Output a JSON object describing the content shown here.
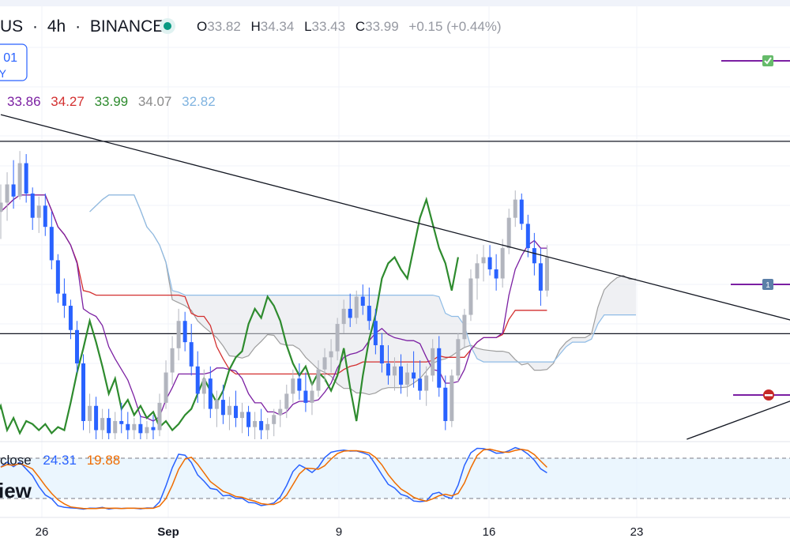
{
  "header": {
    "symbol_tail": "US",
    "sep1": "·",
    "interval": "4h",
    "sep2": "·",
    "exchange": "BINANCE",
    "ohlc": {
      "o_label": "O",
      "o_value": "33.82",
      "h_label": "H",
      "h_value": "34.34",
      "l_label": "L",
      "l_value": "33.43",
      "c_label": "C",
      "c_value": "33.99",
      "change": "+0.15 (+0.44%)"
    }
  },
  "price_badge": {
    "line1": "01",
    "line2": "Y"
  },
  "indicator_values": {
    "v1": "33.86",
    "v2": "34.27",
    "v3": "33.99",
    "v4": "34.07",
    "v5": "32.82"
  },
  "oscillator": {
    "label": "close",
    "k_value": "24.31",
    "d_value": "19.88"
  },
  "watermark": "iew",
  "time_axis": {
    "labels": [
      "26",
      "Sep",
      "9",
      "16",
      "23"
    ]
  },
  "markers": {
    "flag1": "1"
  },
  "colors": {
    "up": "#b2b5be",
    "down": "#2962ff",
    "tenkan": "#7b1fa2",
    "kijun": "#d32f2f",
    "chikou": "#2e8b2e",
    "spanA": "#9e9e9e",
    "spanB": "#8fbce6",
    "stoch_k": "#2962ff",
    "stoch_d": "#ef6c00"
  },
  "chart_data": {
    "type": "candlestick",
    "title": "",
    "interval": "4h",
    "exchange": "BINANCE",
    "last_bar": {
      "open": 33.82,
      "high": 34.34,
      "low": 33.43,
      "close": 33.99,
      "change": 0.15,
      "change_pct": 0.44
    },
    "x_axis_labels": [
      "26",
      "Sep",
      "9",
      "16",
      "23"
    ],
    "price_scale": {
      "y_min": 28.0,
      "y_max": 38.0
    },
    "candles": [
      [
        35.5,
        36.4,
        34.6,
        35.8
      ],
      [
        35.8,
        36.8,
        35.2,
        36.4
      ],
      [
        36.4,
        37.2,
        35.6,
        36.0
      ],
      [
        36.0,
        37.5,
        35.9,
        37.1
      ],
      [
        37.1,
        37.4,
        35.8,
        36.1
      ],
      [
        36.1,
        36.3,
        34.9,
        35.3
      ],
      [
        35.3,
        36.0,
        34.8,
        35.7
      ],
      [
        35.7,
        36.1,
        34.7,
        35.0
      ],
      [
        35.0,
        35.5,
        33.6,
        33.9
      ],
      [
        33.9,
        34.1,
        32.5,
        32.8
      ],
      [
        32.8,
        33.3,
        32.0,
        32.4
      ],
      [
        32.4,
        32.6,
        31.3,
        31.6
      ],
      [
        31.6,
        31.9,
        30.2,
        30.5
      ],
      [
        30.5,
        30.8,
        28.3,
        28.6
      ],
      [
        28.6,
        29.5,
        28.2,
        29.1
      ],
      [
        29.1,
        29.4,
        28.0,
        28.3
      ],
      [
        28.3,
        29.0,
        28.0,
        28.7
      ],
      [
        28.7,
        29.0,
        28.0,
        28.2
      ],
      [
        28.2,
        28.9,
        28.0,
        28.6
      ],
      [
        28.6,
        29.2,
        28.2,
        28.5
      ],
      [
        28.5,
        28.9,
        28.0,
        28.3
      ],
      [
        28.3,
        28.7,
        28.0,
        28.5
      ],
      [
        28.5,
        28.8,
        28.0,
        28.2
      ],
      [
        28.2,
        28.6,
        28.0,
        28.4
      ],
      [
        28.4,
        28.8,
        28.0,
        28.3
      ],
      [
        28.3,
        29.5,
        28.1,
        29.2
      ],
      [
        29.2,
        30.6,
        29.0,
        30.2
      ],
      [
        30.2,
        31.4,
        29.8,
        31.0
      ],
      [
        31.0,
        32.3,
        30.6,
        31.9
      ],
      [
        31.9,
        32.2,
        30.9,
        31.2
      ],
      [
        31.2,
        31.8,
        30.1,
        30.4
      ],
      [
        30.4,
        30.9,
        29.2,
        29.5
      ],
      [
        29.5,
        30.3,
        29.0,
        30.0
      ],
      [
        30.0,
        30.4,
        28.7,
        29.0
      ],
      [
        29.0,
        29.6,
        28.4,
        29.3
      ],
      [
        29.3,
        29.8,
        28.5,
        28.8
      ],
      [
        28.8,
        29.4,
        28.3,
        29.1
      ],
      [
        29.1,
        29.6,
        28.4,
        28.7
      ],
      [
        28.7,
        29.2,
        28.2,
        28.9
      ],
      [
        28.9,
        29.1,
        28.1,
        28.4
      ],
      [
        28.4,
        28.9,
        28.0,
        28.6
      ],
      [
        28.6,
        29.0,
        28.0,
        28.3
      ],
      [
        28.3,
        28.7,
        28.0,
        28.5
      ],
      [
        28.5,
        29.0,
        28.1,
        28.8
      ],
      [
        28.8,
        29.3,
        28.4,
        29.0
      ],
      [
        29.0,
        29.8,
        28.7,
        29.5
      ],
      [
        29.5,
        30.3,
        29.2,
        30.0
      ],
      [
        30.0,
        30.5,
        29.3,
        29.6
      ],
      [
        29.6,
        30.2,
        28.9,
        29.2
      ],
      [
        29.2,
        29.9,
        28.8,
        29.6
      ],
      [
        29.6,
        30.6,
        29.4,
        30.3
      ],
      [
        30.3,
        31.0,
        29.9,
        30.7
      ],
      [
        30.7,
        31.3,
        30.2,
        30.9
      ],
      [
        30.9,
        32.0,
        30.6,
        31.8
      ],
      [
        31.8,
        32.6,
        31.5,
        32.3
      ],
      [
        32.3,
        32.8,
        31.7,
        32.0
      ],
      [
        32.0,
        32.9,
        31.8,
        32.7
      ],
      [
        32.7,
        33.1,
        32.1,
        32.4
      ],
      [
        32.4,
        33.0,
        31.6,
        31.9
      ],
      [
        31.9,
        32.3,
        30.8,
        31.1
      ],
      [
        31.1,
        31.5,
        30.2,
        30.5
      ],
      [
        30.5,
        31.1,
        29.8,
        30.1
      ],
      [
        30.1,
        30.7,
        29.6,
        30.4
      ],
      [
        30.4,
        30.8,
        29.5,
        29.8
      ],
      [
        29.8,
        30.5,
        29.4,
        30.2
      ],
      [
        30.2,
        30.9,
        29.7,
        30.0
      ],
      [
        30.0,
        30.6,
        29.3,
        29.6
      ],
      [
        29.6,
        30.4,
        29.1,
        30.1
      ],
      [
        30.1,
        31.3,
        29.9,
        31.0
      ],
      [
        31.0,
        31.4,
        29.4,
        29.7
      ],
      [
        29.7,
        30.1,
        28.3,
        28.6
      ],
      [
        28.6,
        30.3,
        28.4,
        30.1
      ],
      [
        30.1,
        31.5,
        29.9,
        31.3
      ],
      [
        31.3,
        32.3,
        31.0,
        32.1
      ],
      [
        32.1,
        33.6,
        31.9,
        33.3
      ],
      [
        33.3,
        34.1,
        32.6,
        33.8
      ],
      [
        33.8,
        34.4,
        33.2,
        34.0
      ],
      [
        34.0,
        34.4,
        33.4,
        33.6
      ],
      [
        33.6,
        34.1,
        32.9,
        33.3
      ],
      [
        33.3,
        34.6,
        33.0,
        34.3
      ],
      [
        34.3,
        35.6,
        34.1,
        35.3
      ],
      [
        35.3,
        36.2,
        35.0,
        35.9
      ],
      [
        35.9,
        36.1,
        34.9,
        35.1
      ],
      [
        35.1,
        35.4,
        34.0,
        34.3
      ],
      [
        34.3,
        34.8,
        33.4,
        33.8
      ],
      [
        33.8,
        34.3,
        32.4,
        32.9
      ],
      [
        32.9,
        34.4,
        32.7,
        34.0
      ]
    ],
    "indicator_last_values": {
      "tenkan_sen": 33.86,
      "kijun_sen": 34.27,
      "chikou_span": 33.99,
      "senkou_span_a": 34.07,
      "senkou_span_b": 32.82
    },
    "stochastic": {
      "k": 24.31,
      "d": 19.88,
      "bands": [
        80,
        20
      ]
    },
    "horizontal_lines": [
      37.82,
      31.48
    ],
    "trend_lines": [
      {
        "from": [
          0,
          38.7
        ],
        "to": [
          180,
          28.9
        ]
      },
      {
        "from": [
          108,
          28.0
        ],
        "to": [
          200,
          35.1
        ]
      }
    ]
  }
}
